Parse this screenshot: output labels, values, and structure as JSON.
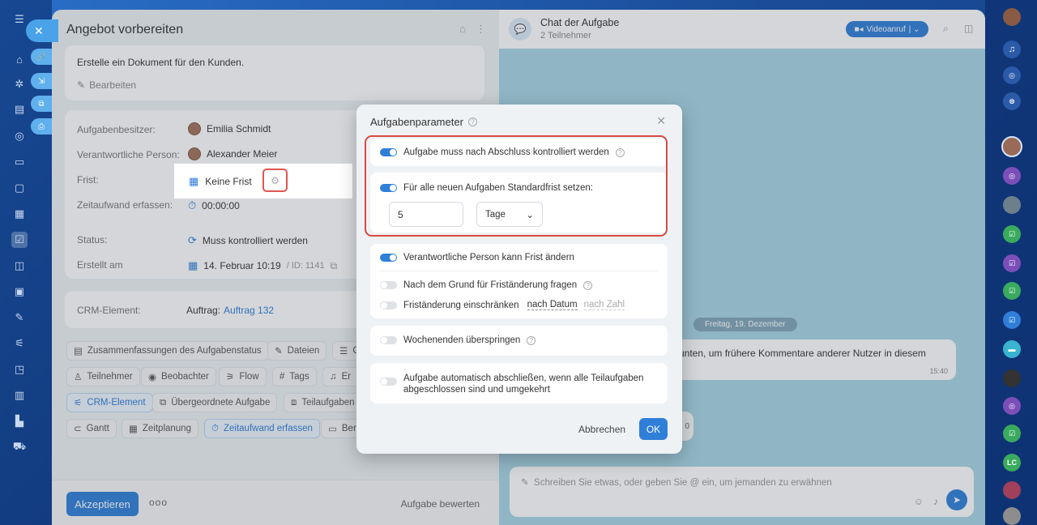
{
  "task": {
    "title": "Angebot vorbereiten",
    "description": "Erstelle ein Dokument für den Kunden.",
    "edit_label": "Bearbeiten",
    "fields": {
      "owner_label": "Aufgabenbesitzer:",
      "owner_value": "Emilia Schmidt",
      "responsible_label": "Verantwortliche Person:",
      "responsible_value": "Alexander Meier",
      "deadline_label": "Frist:",
      "deadline_value": "Keine Frist",
      "time_label": "Zeitaufwand erfassen:",
      "time_value": "00:00:00",
      "status_label": "Status:",
      "status_value": "Muss kontrolliert werden",
      "created_label": "Erstellt am",
      "created_value": "14. Februar 10:19",
      "created_id": "/ ID: 1141"
    },
    "crm": {
      "label": "CRM-Element:",
      "prefix": "Auftrag:",
      "link": "Auftrag 132"
    },
    "chips": [
      "Zusammenfassungen des Aufgabenstatus",
      "Dateien",
      "C",
      "Teilnehmer",
      "Beobachter",
      "Flow",
      "Tags",
      "Er",
      "CRM-Element",
      "Übergeordnete Aufgabe",
      "Teilaufgaben",
      "Gantt",
      "Zeitplanung",
      "Zeitaufwand erfassen",
      "Ber"
    ],
    "accept_label": "Akzeptieren",
    "more_label": "ooo",
    "rate_label": "Aufgabe bewerten"
  },
  "chat": {
    "title": "Chat der Aufgabe",
    "subtitle": "2 Teilnehmer",
    "video_label": "Videoanruf",
    "date_pill": "Freitag, 19. Dezember",
    "message_text": "unten, um frühere Kommentare anderer Nutzer in diesem",
    "message_time": "15:40",
    "message2_text": "0",
    "input_placeholder": "Schreiben Sie etwas, oder geben Sie @ ein, um jemanden zu erwähnen"
  },
  "dialog": {
    "title": "Aufgabenparameter",
    "opt_control": "Aufgabe muss nach Abschluss kontrolliert werden",
    "opt_default_deadline": "Für alle neuen Aufgaben Standardfrist setzen:",
    "deadline_number": "5",
    "deadline_unit": "Tage",
    "opt_responsible_change": "Verantwortliche Person kann Frist ändern",
    "opt_ask_reason": "Nach dem Grund für Friständerung fragen",
    "opt_restrict": "Friständerung einschränken",
    "restrict_by_date": "nach Datum",
    "restrict_by_number": "nach Zahl",
    "opt_weekends": "Wochenenden überspringen",
    "opt_autocomplete": "Aufgabe automatisch abschließen, wenn alle Teilaufgaben abgeschlossen sind und umgekehrt",
    "cancel_label": "Abbrechen",
    "ok_label": "OK"
  },
  "rrail_avatar_text": "LC",
  "colors": {
    "accent": "#2f7fd9",
    "highlight": "#d94a43"
  }
}
